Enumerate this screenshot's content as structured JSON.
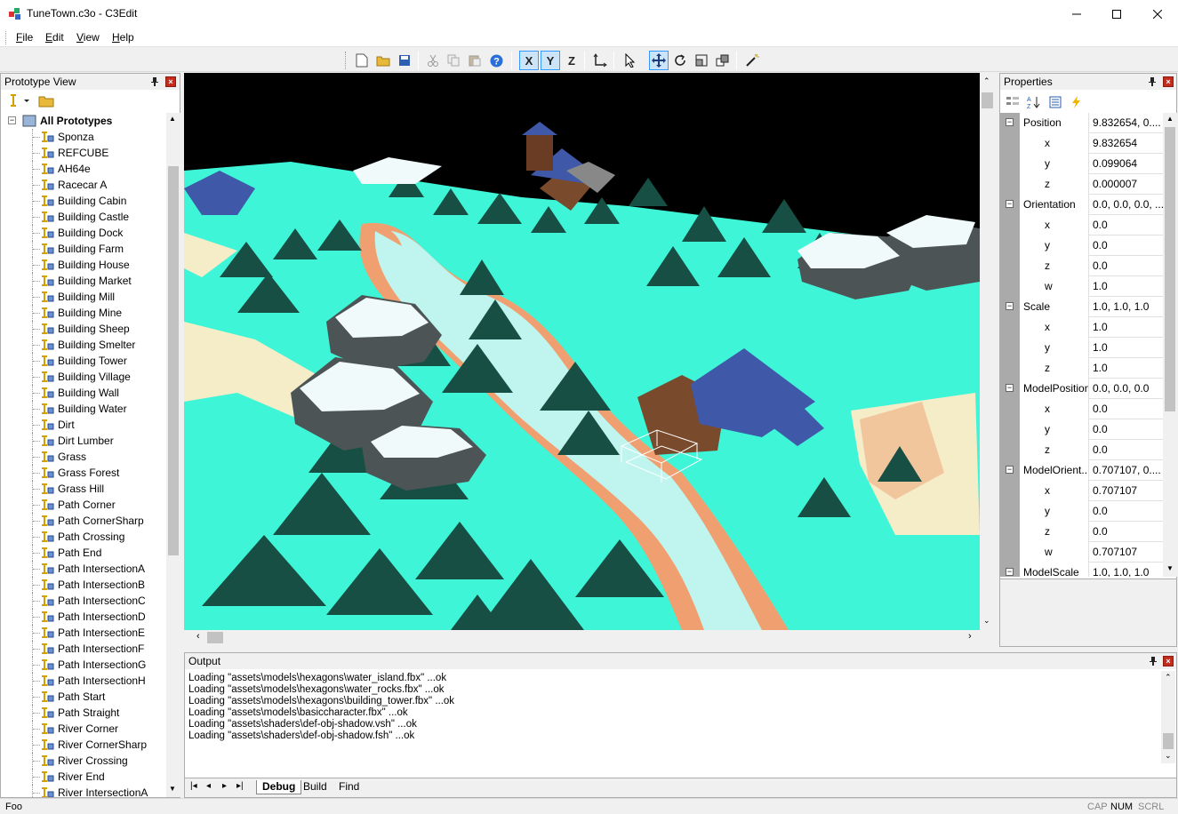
{
  "window": {
    "title": "TuneTown.c3o - C3Edit"
  },
  "menu": [
    {
      "label": "File",
      "underline": "F",
      "rest": "ile"
    },
    {
      "label": "Edit",
      "underline": "E",
      "rest": "dit"
    },
    {
      "label": "View",
      "underline": "V",
      "rest": "iew"
    },
    {
      "label": "Help",
      "underline": "H",
      "rest": "elp"
    }
  ],
  "toolbar": {
    "axis_x": "X",
    "axis_y": "Y",
    "axis_z": "Z"
  },
  "prototype_view": {
    "title": "Prototype View",
    "root": "All Prototypes",
    "items": [
      "Sponza",
      "REFCUBE",
      "AH64e",
      "Racecar A",
      "Building Cabin",
      "Building Castle",
      "Building Dock",
      "Building Farm",
      "Building House",
      "Building Market",
      "Building Mill",
      "Building Mine",
      "Building Sheep",
      "Building Smelter",
      "Building Tower",
      "Building Village",
      "Building Wall",
      "Building Water",
      "Dirt",
      "Dirt Lumber",
      "Grass",
      "Grass Forest",
      "Grass Hill",
      "Path Corner",
      "Path CornerSharp",
      "Path Crossing",
      "Path End",
      "Path IntersectionA",
      "Path IntersectionB",
      "Path IntersectionC",
      "Path IntersectionD",
      "Path IntersectionE",
      "Path IntersectionF",
      "Path IntersectionG",
      "Path IntersectionH",
      "Path Start",
      "Path Straight",
      "River Corner",
      "River CornerSharp",
      "River Crossing",
      "River End",
      "River IntersectionA"
    ]
  },
  "properties": {
    "title": "Properties",
    "rows": [
      {
        "name": "Position",
        "value": "9.832654, 0....",
        "group": true
      },
      {
        "name": "x",
        "value": "9.832654"
      },
      {
        "name": "y",
        "value": "0.099064"
      },
      {
        "name": "z",
        "value": "0.000007"
      },
      {
        "name": "Orientation",
        "value": "0.0, 0.0, 0.0, ...",
        "group": true
      },
      {
        "name": "x",
        "value": "0.0"
      },
      {
        "name": "y",
        "value": "0.0"
      },
      {
        "name": "z",
        "value": "0.0"
      },
      {
        "name": "w",
        "value": "1.0"
      },
      {
        "name": "Scale",
        "value": "1.0, 1.0, 1.0",
        "group": true
      },
      {
        "name": "x",
        "value": "1.0"
      },
      {
        "name": "y",
        "value": "1.0"
      },
      {
        "name": "z",
        "value": "1.0"
      },
      {
        "name": "ModelPosition",
        "value": "0.0, 0.0, 0.0",
        "group": true
      },
      {
        "name": "x",
        "value": "0.0"
      },
      {
        "name": "y",
        "value": "0.0"
      },
      {
        "name": "z",
        "value": "0.0"
      },
      {
        "name": "ModelOrient...",
        "value": "0.707107, 0....",
        "group": true
      },
      {
        "name": "x",
        "value": "0.707107"
      },
      {
        "name": "y",
        "value": "0.0"
      },
      {
        "name": "z",
        "value": "0.0"
      },
      {
        "name": "w",
        "value": "0.707107"
      },
      {
        "name": "ModelScale",
        "value": "1.0, 1.0, 1.0",
        "group": true
      }
    ]
  },
  "output": {
    "title": "Output",
    "lines": [
      "Loading \"assets\\models\\hexagons\\water_island.fbx\" ...ok",
      "Loading \"assets\\models\\hexagons\\water_rocks.fbx\" ...ok",
      "Loading \"assets\\models\\hexagons\\building_tower.fbx\" ...ok",
      "Loading \"assets\\models\\basiccharacter.fbx\" ...ok",
      "Loading \"assets\\shaders\\def-obj-shadow.vsh\" ...ok",
      "Loading \"assets\\shaders\\def-obj-shadow.fsh\" ...ok"
    ],
    "tabs": [
      "Debug",
      "Build",
      "Find"
    ]
  },
  "status": {
    "text": "Foo",
    "cap": "CAP",
    "num": "NUM",
    "scrl": "SCRL"
  },
  "colors": {
    "sky": "#000000",
    "grass": "#3ff5d8",
    "river": "#bff5ee",
    "path": "#f0a070",
    "tree": "#174f44",
    "roof": "#3f58a8",
    "rock": "#4d5456",
    "snow": "#f0fafa"
  },
  "icons": [
    "app-icon",
    "minimize-icon",
    "maximize-icon",
    "close-icon",
    "new-file-icon",
    "open-folder-icon",
    "save-icon",
    "cut-icon",
    "copy-icon",
    "paste-icon",
    "help-icon",
    "local-axes-icon",
    "select-arrow-icon",
    "move-icon",
    "rotate-icon",
    "scale-icon",
    "snap-icon",
    "magic-wand-icon",
    "pin-icon",
    "prototype-icon",
    "folder-icon",
    "categorized-icon",
    "alphabetical-icon",
    "property-pages-icon",
    "events-icon"
  ]
}
